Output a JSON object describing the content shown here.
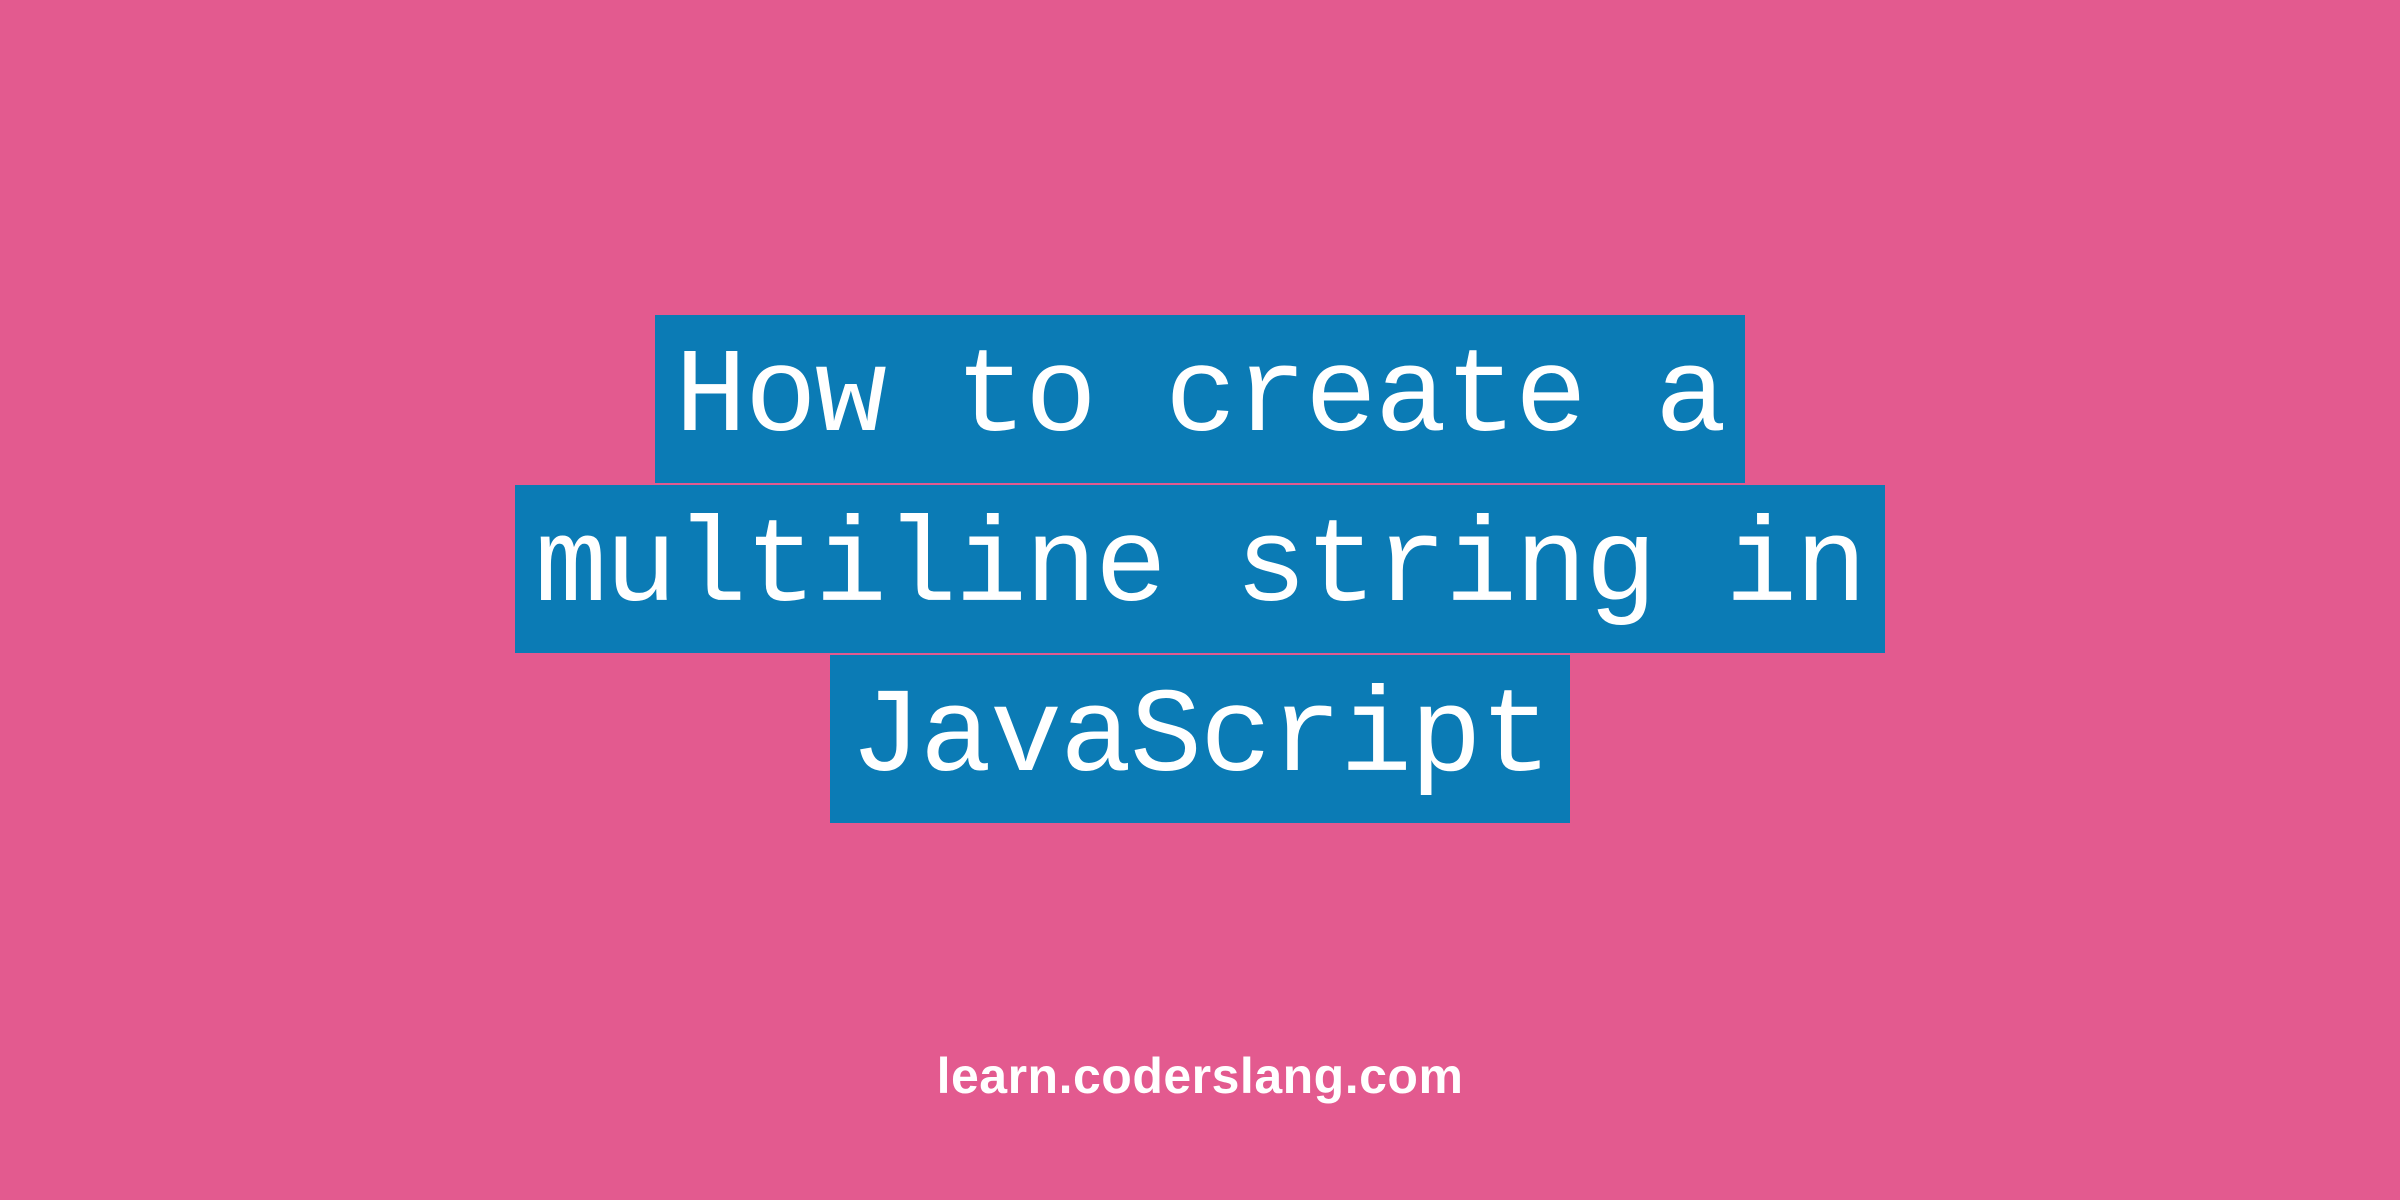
{
  "title": {
    "line1": "How to create a",
    "line2": "multiline string in",
    "line3": "JavaScript"
  },
  "footer": "learn.coderslang.com",
  "colors": {
    "background": "#e35a8f",
    "highlight": "#0b7bb5",
    "text": "#ffffff"
  }
}
